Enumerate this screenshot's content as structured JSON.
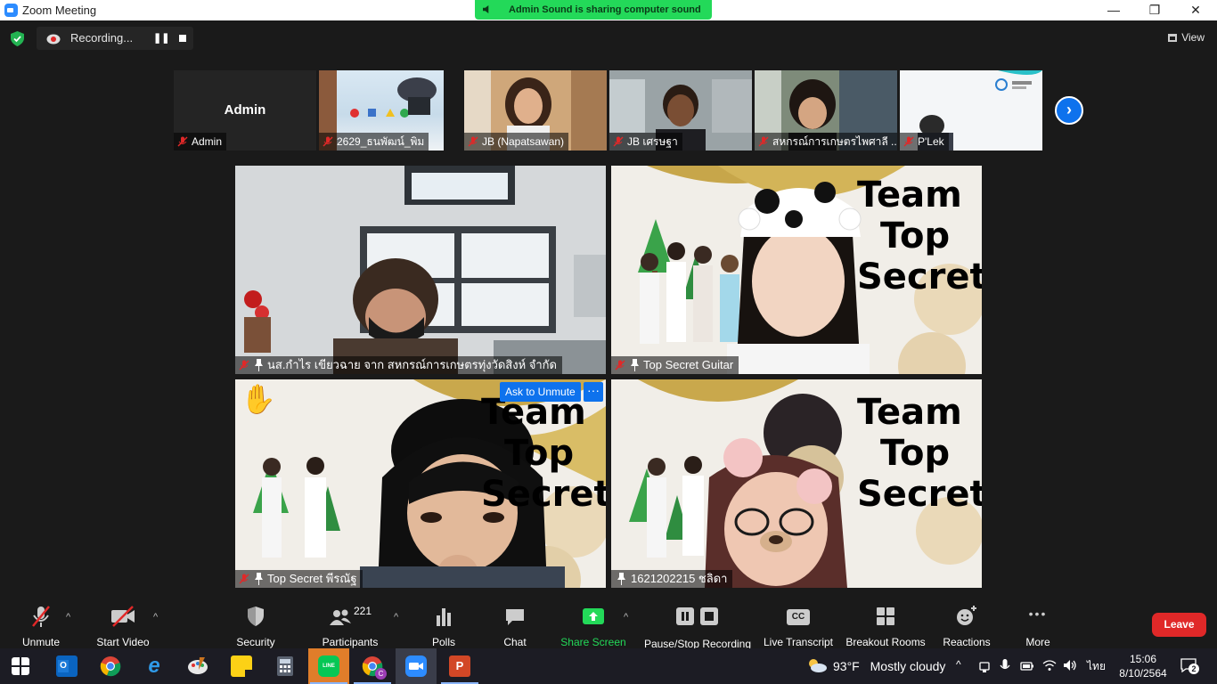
{
  "window": {
    "title": "Zoom Meeting",
    "minimize": "—",
    "maximize": "❐",
    "close": "✕"
  },
  "share_banner": "Admin Sound is sharing computer sound",
  "recording": {
    "label": "Recording...",
    "pause": "❚❚"
  },
  "view": {
    "label": "View"
  },
  "strip": {
    "tiles": [
      {
        "name": "Admin",
        "big_label": "Admin",
        "muted": true
      },
      {
        "name": "2629_ธนพัฒน์_พิม",
        "muted": true
      },
      {
        "name": "JB (Napatsawan)",
        "muted": true
      },
      {
        "name": "JB เศรษฐา",
        "muted": true
      },
      {
        "name": "สหกรณ์การเกษตรไพศาลี ...",
        "muted": true
      },
      {
        "name": "P'Lek",
        "muted": true
      }
    ],
    "next": "›"
  },
  "gallery": [
    {
      "name": "นส.กำไร  เขียวฉาย จาก สหกรณ์การเกษตรทุ่งวัดสิงห์  จำกัด",
      "muted": true
    },
    {
      "name": "Top Secret Guitar",
      "muted": true,
      "bg_text": [
        "Team",
        "Top",
        "Secret"
      ]
    },
    {
      "name": "Top Secret พีรณัฐ",
      "muted": true,
      "raised_hand": "✋",
      "ask_unmute": "Ask to Unmute",
      "more": "···",
      "bg_text": [
        "Team",
        "Top",
        "Secret"
      ]
    },
    {
      "name": "1621202215 ชลิดา",
      "muted": false,
      "bg_text": [
        "Team",
        "Top",
        "Secret"
      ]
    }
  ],
  "toolbar": {
    "unmute": "Unmute",
    "start_video": "Start Video",
    "security": "Security",
    "participants": "Participants",
    "participants_count": "221",
    "polls": "Polls",
    "chat": "Chat",
    "share_screen": "Share Screen",
    "pause_stop": "Pause/Stop Recording",
    "live_transcript": "Live Transcript",
    "cc": "CC",
    "breakout": "Breakout Rooms",
    "reactions": "Reactions",
    "more": "More",
    "more_dots": "•••",
    "caret": "^",
    "leave": "Leave"
  },
  "taskbar": {
    "weather_temp": "93°F",
    "weather_desc": "Mostly cloudy",
    "lang": "ไทย",
    "time": "15:06",
    "date": "8/10/2564",
    "notifications": "2",
    "line_label": "LINE",
    "chrome_badge": "C"
  },
  "colors": {
    "zoom_blue": "#0e72ed",
    "share_green": "#23d959",
    "leave_red": "#e02828",
    "muted_red": "#e02828"
  }
}
